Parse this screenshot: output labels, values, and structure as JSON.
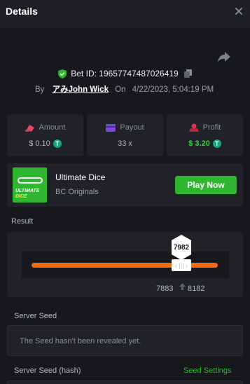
{
  "header": {
    "title": "Details",
    "close_icon": "close-icon"
  },
  "bet": {
    "id_label": "Bet ID: 19657747487026419",
    "by_label": "By",
    "username": "アみJohn Wick",
    "on_label": "On",
    "datetime": "4/22/2023, 5:04:19 PM"
  },
  "stats": {
    "amount": {
      "label": "Amount",
      "value": "$ 0.10",
      "icon": "amount-icon"
    },
    "payout": {
      "label": "Payout",
      "value": "33 x",
      "icon": "card-icon"
    },
    "profit": {
      "label": "Profit",
      "value": "$ 3.20",
      "icon": "profit-icon"
    },
    "coin_glyph": "T"
  },
  "game": {
    "name": "Ultimate Dice",
    "provider": "BC Originals",
    "play_label": "Play Now",
    "thumb_line1": "ULTIMATE",
    "thumb_line2": "DICE"
  },
  "result": {
    "label": "Result",
    "roll": "7982",
    "range_low": "7883",
    "range_high": "8182",
    "handle_glyph": "‹ ||| ›"
  },
  "server_seed": {
    "label": "Server Seed",
    "message": "The Seed hasn't been revealed yet."
  },
  "server_seed_hash": {
    "label": "Server Seed (hash)",
    "settings_link": "Seed Settings"
  },
  "colors": {
    "background": "#17181b",
    "panel": "#202227",
    "accent_green": "#2fb52f",
    "profit_green": "#2fd34e",
    "bar_orange": "#f26b12",
    "coin_teal": "#1aa47a"
  }
}
